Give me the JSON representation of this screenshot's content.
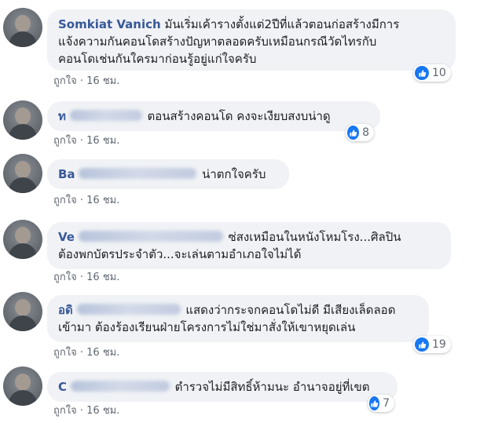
{
  "comments": [
    {
      "author_visible": "Somkiat Vanich",
      "text": "มันเริ่มเค้ารางตั้งแต่2ปีที่แล้วตอนก่อสร้างมีการแจ้งความกันคอนโดสร้างปัญหาตลอดครับเหมือนกรณีวัดไทรกับคอนโดเช่นกันใครมาก่อนรู้อยู่แก่ใจครับ",
      "line1": "มันเริ่มเค้ารางตั้งแต่2ปีที่แล้วตอนก่อสร้างมีการ",
      "line2": "แจ้งความกันคอนโดสร้างปัญหาตลอดครับเหมือนกรณีวัดไทรกับ",
      "line3": "คอนโดเช่นกันใครมาก่อนรู้อยู่แก่ใจครับ",
      "like_label": "ถูกใจ",
      "separator": "·",
      "time": "16 ชม.",
      "reactions": "10"
    },
    {
      "author_visible": "ท",
      "text": "ตอนสร้างคอนโด คงจะเงียบสงบน่าดู",
      "like_label": "ถูกใจ",
      "separator": "·",
      "time": "16 ชม.",
      "reactions": "8"
    },
    {
      "author_visible": "Ba",
      "text": "น่าตกใจครับ",
      "like_label": "ถูกใจ",
      "separator": "·",
      "time": "16 ชม."
    },
    {
      "author_visible": "Ve",
      "line1": "ซ่สงเหมือนในหนังโหมโรง...ศิลปิน",
      "line2": "ต้องพกบัตรประจำตัว...จะเล่นตามอำเภอใจไม่ได้",
      "like_label": "ถูกใจ",
      "separator": "·",
      "time": "16 ชม."
    },
    {
      "author_visible": "อดิ",
      "line1": "แสดงว่ากระจกคอนโดไม่ดี มีเสียงเล็ดลอด",
      "line2": "เข้ามา ต้องร้องเรียนฝ่ายโครงการไม่ใช่มาสั่งให้เขาหยุดเล่น",
      "like_label": "ถูกใจ",
      "separator": "·",
      "time": "16 ชม.",
      "reactions": "19"
    },
    {
      "author_visible": "C",
      "text": "ตำรวจไม่มีสิทธิ์ห้ามนะ อำนาจอยู่ที่เขต",
      "like_label": "ถูกใจ",
      "separator": "·",
      "time": "16 ชม.",
      "reactions": "7"
    }
  ],
  "colors": {
    "author": "#385898",
    "bubble": "#f0f2f5",
    "like_blue": "#1877f2",
    "meta": "#606770"
  }
}
